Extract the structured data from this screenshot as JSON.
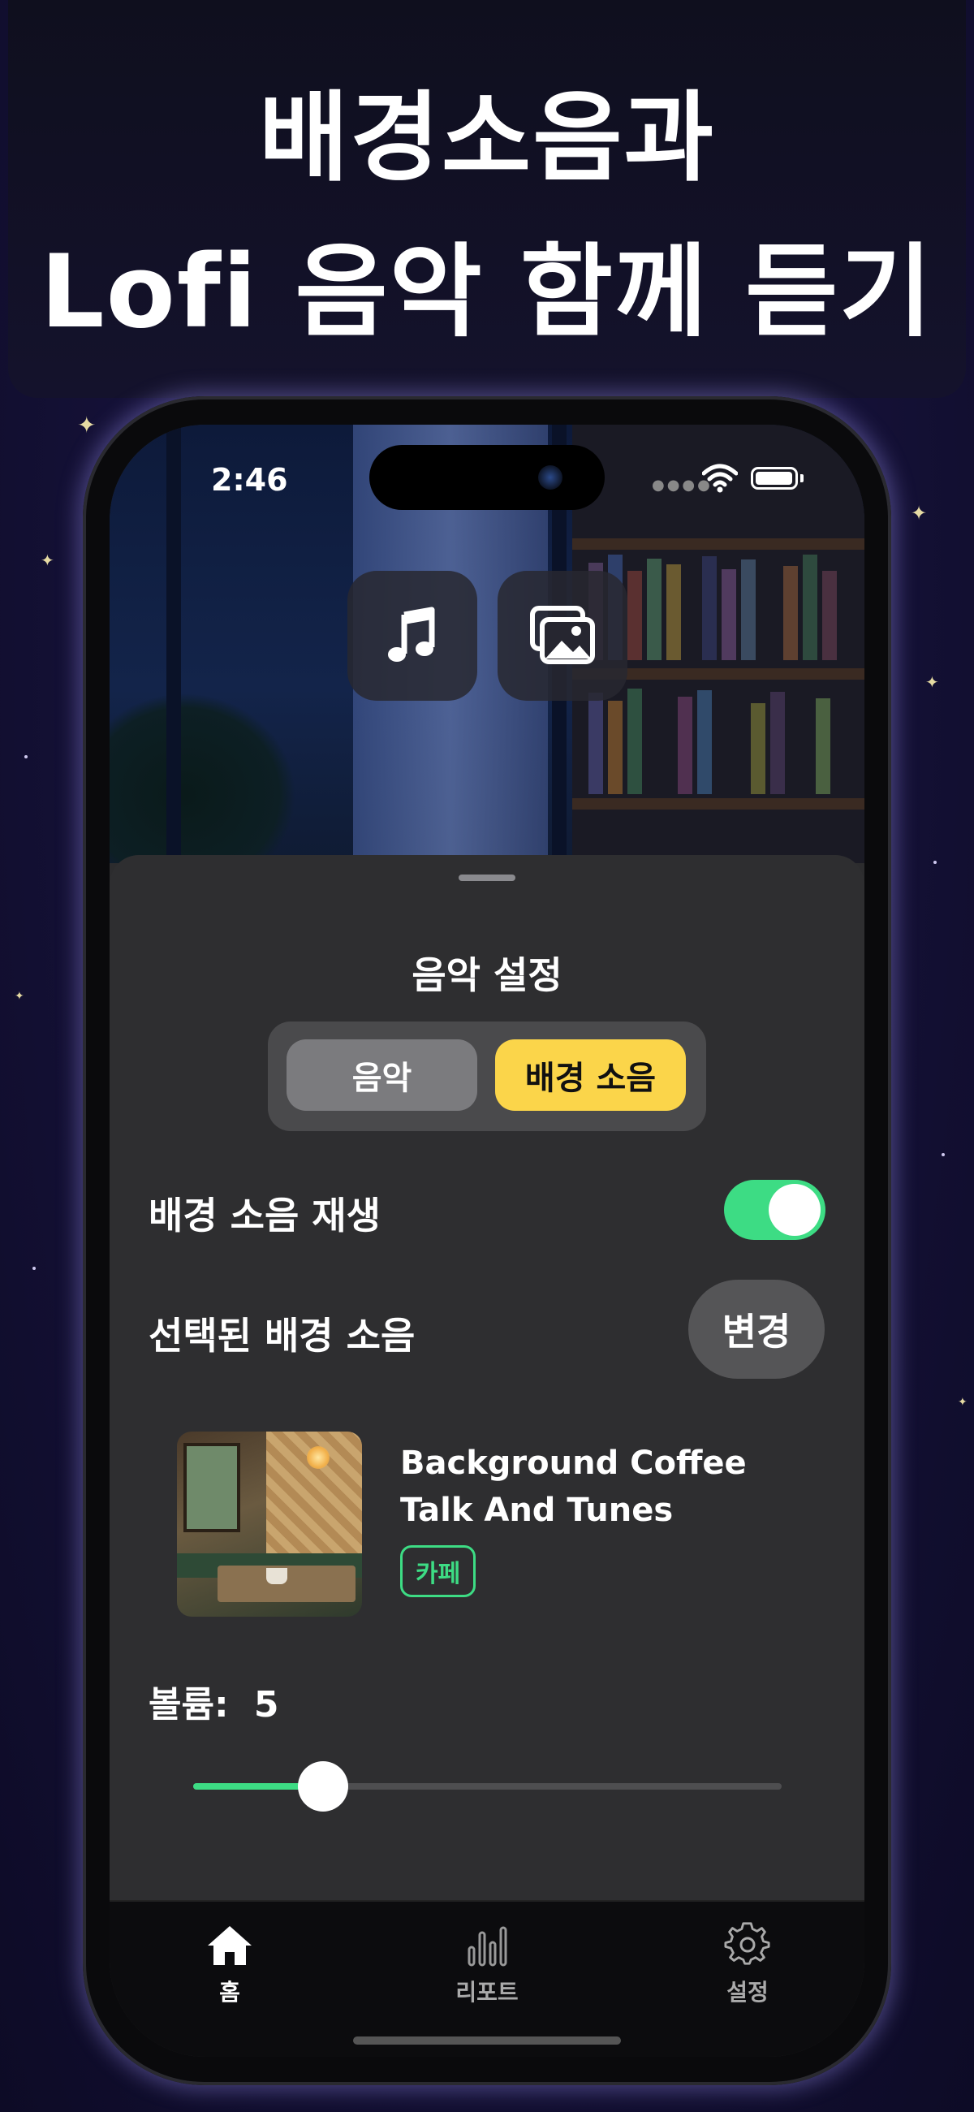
{
  "headline": {
    "line1": "배경소음과",
    "line2": "Lofi 음악 함께 듣기"
  },
  "status_bar": {
    "time": "2:46"
  },
  "top_buttons": {
    "music_icon": "music-note-icon",
    "background_icon": "gallery-icon"
  },
  "sheet": {
    "title": "음악 설정",
    "segments": [
      {
        "label": "음악",
        "selected": false
      },
      {
        "label": "배경 소음",
        "selected": true
      }
    ],
    "background_noise_play": {
      "label": "배경 소음 재생",
      "on": true
    },
    "selected_noise": {
      "label": "선택된 배경 소음",
      "change_label": "변경"
    },
    "track": {
      "title": "Background Coffee Talk And Tunes",
      "tag": "카페"
    },
    "volume": {
      "label": "볼륨:",
      "value": "5",
      "fraction": 0.22
    }
  },
  "tab_bar": {
    "items": [
      {
        "label": "홈",
        "icon": "home-icon",
        "active": true
      },
      {
        "label": "리포트",
        "icon": "bar-chart-icon",
        "active": false
      },
      {
        "label": "설정",
        "icon": "gear-icon",
        "active": false
      }
    ]
  },
  "colors": {
    "accent_green": "#3ddc84",
    "accent_yellow": "#fbd54a",
    "sheet_bg": "#2e2e30"
  }
}
